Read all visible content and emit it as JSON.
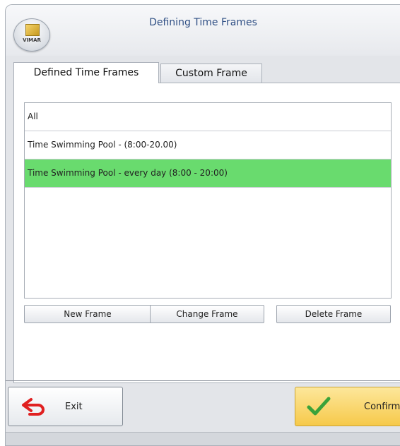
{
  "window": {
    "title": "Defining Time Frames",
    "logo_text": "VIMAR"
  },
  "tabs": [
    {
      "label": "Defined Time Frames",
      "active": true
    },
    {
      "label": "Custom Frame",
      "active": false
    }
  ],
  "time_frames": [
    {
      "label": "All",
      "selected": false
    },
    {
      "label": "Time Swimming Pool - (8:00-20.00)",
      "selected": false
    },
    {
      "label": "Time Swimming Pool - every day (8:00 - 20:00)",
      "selected": true
    }
  ],
  "buttons": {
    "new_frame": "New Frame",
    "change_frame": "Change Frame",
    "delete_frame": "Delete Frame"
  },
  "footer": {
    "exit_label": "Exit",
    "confirm_label": "Confirm"
  },
  "icons": {
    "exit": "undo-arrow-icon",
    "confirm": "checkmark-icon",
    "logo": "vimar-logo"
  },
  "colors": {
    "title_text": "#2f4f84",
    "selected_row": "#69db6e",
    "exit_icon": "#e02020",
    "confirm_icon": "#3aa23a",
    "confirm_button": "#f6c94a"
  }
}
